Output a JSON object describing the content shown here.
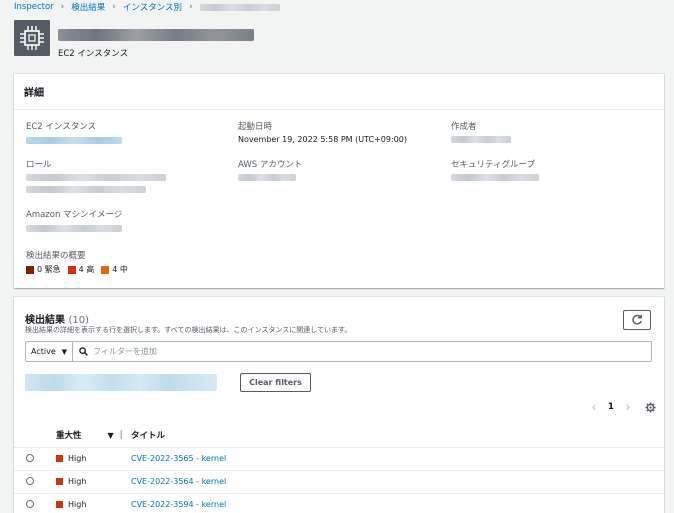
{
  "breadcrumb": {
    "items": [
      "Inspector",
      "検出結果",
      "インスタンス別"
    ]
  },
  "header": {
    "subtitle": "EC2 インスタンス"
  },
  "details": {
    "title": "詳細",
    "ec2_instance_label": "EC2 インスタンス",
    "launch_time_label": "起動日時",
    "launch_time_value": "November 19, 2022 5:58 PM (UTC+09:00)",
    "created_by_label": "作成者",
    "role_label": "ロール",
    "aws_account_label": "AWS アカウント",
    "security_group_label": "セキュリティグループ",
    "ami_label": "Amazon マシンイメージ",
    "summary_label": "検出結果の概要",
    "severity_summary": [
      {
        "text": "0 緊急",
        "color": "#7d2105"
      },
      {
        "text": "4 高",
        "color": "#d13212"
      },
      {
        "text": "4 中",
        "color": "#dd6b10"
      }
    ]
  },
  "findings": {
    "title": "検出結果",
    "count": "(10)",
    "description": "検出結果の詳細を表示する行を選択します。すべての検出結果は、このインスタンスに関連しています。",
    "filter_select": "Active",
    "filter_placeholder": "フィルターを追加",
    "clear_filters": "Clear filters",
    "page": "1",
    "columns": {
      "severity": "重大性",
      "title": "タイトル"
    },
    "rows": [
      {
        "severity": "High",
        "title": "CVE-2022-3565 - kernel"
      },
      {
        "severity": "High",
        "title": "CVE-2022-3564 - kernel"
      },
      {
        "severity": "High",
        "title": "CVE-2022-3594 - kernel"
      }
    ]
  }
}
